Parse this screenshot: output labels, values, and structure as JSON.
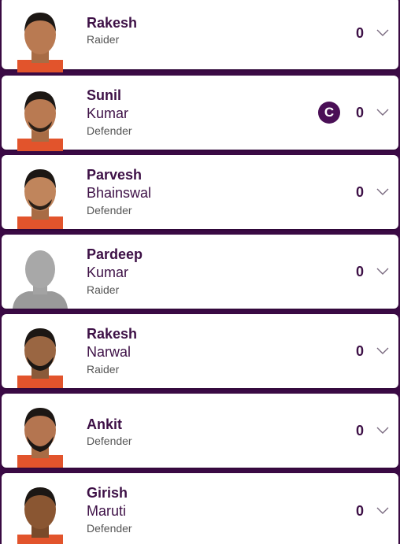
{
  "players": [
    {
      "first": "Rakesh",
      "last": "",
      "role": "Raider",
      "points": "0",
      "captain": false,
      "avatar_icon": "player-photo",
      "captain_label": ""
    },
    {
      "first": "Sunil",
      "last": "Kumar",
      "role": "Defender",
      "points": "0",
      "captain": true,
      "avatar_icon": "player-photo",
      "captain_label": "C"
    },
    {
      "first": "Parvesh",
      "last": "Bhainswal",
      "role": "Defender",
      "points": "0",
      "captain": false,
      "avatar_icon": "player-photo",
      "captain_label": ""
    },
    {
      "first": "Pardeep",
      "last": "Kumar",
      "role": "Raider",
      "points": "0",
      "captain": false,
      "avatar_icon": "silhouette-placeholder",
      "captain_label": ""
    },
    {
      "first": "Rakesh",
      "last": "Narwal",
      "role": "Raider",
      "points": "0",
      "captain": false,
      "avatar_icon": "player-photo",
      "captain_label": ""
    },
    {
      "first": "Ankit",
      "last": "",
      "role": "Defender",
      "points": "0",
      "captain": false,
      "avatar_icon": "player-photo",
      "captain_label": ""
    },
    {
      "first": "Girish",
      "last": "Maruti",
      "role": "Defender",
      "points": "0",
      "captain": false,
      "avatar_icon": "player-photo",
      "captain_label": ""
    }
  ],
  "colors": {
    "background": "#3b0a45",
    "card": "#ffffff",
    "text": "#3d1046",
    "jersey": "#e2542c"
  }
}
